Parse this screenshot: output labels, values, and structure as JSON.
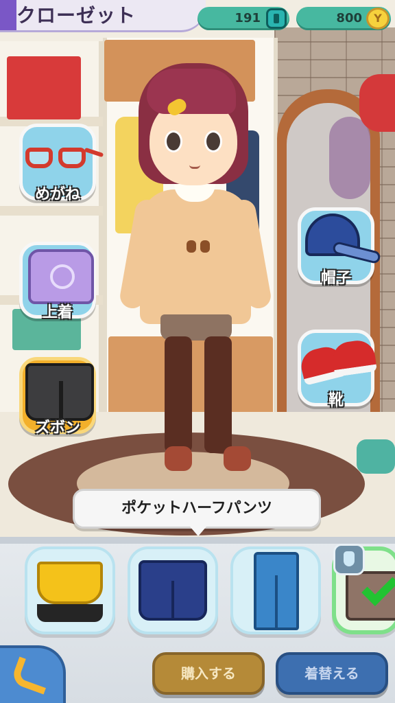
{
  "header": {
    "title": "クローゼット",
    "points": "191",
    "money": "800",
    "money_symbol": "Y",
    "points_icon": "youkai-watch-card-icon",
    "money_icon": "yen-coin-icon"
  },
  "categories": {
    "glasses": "めがね",
    "tops": "上着",
    "bottoms": "ズボン",
    "hat": "帽子",
    "shoes": "靴"
  },
  "selected_category": "bottoms",
  "tooltip": {
    "text": "ポケットハーフパンツ"
  },
  "items": [
    {
      "icon": "skirt-icon",
      "selected": false
    },
    {
      "icon": "denim-shorts-icon",
      "selected": false
    },
    {
      "icon": "jeans-icon",
      "selected": false
    },
    {
      "icon": "pocket-shorts-icon",
      "selected": true
    }
  ],
  "actions": {
    "buy": "購入する",
    "wear": "着替える",
    "back_icon": "back-arrow-icon"
  },
  "colors": {
    "category_bg": "#8fd3ea",
    "category_active": "#f3b02b",
    "currency_pill": "#47b8a0",
    "buy_button": "#b58a38",
    "wear_button": "#3d6fb0",
    "selected_check": "#22c332"
  }
}
